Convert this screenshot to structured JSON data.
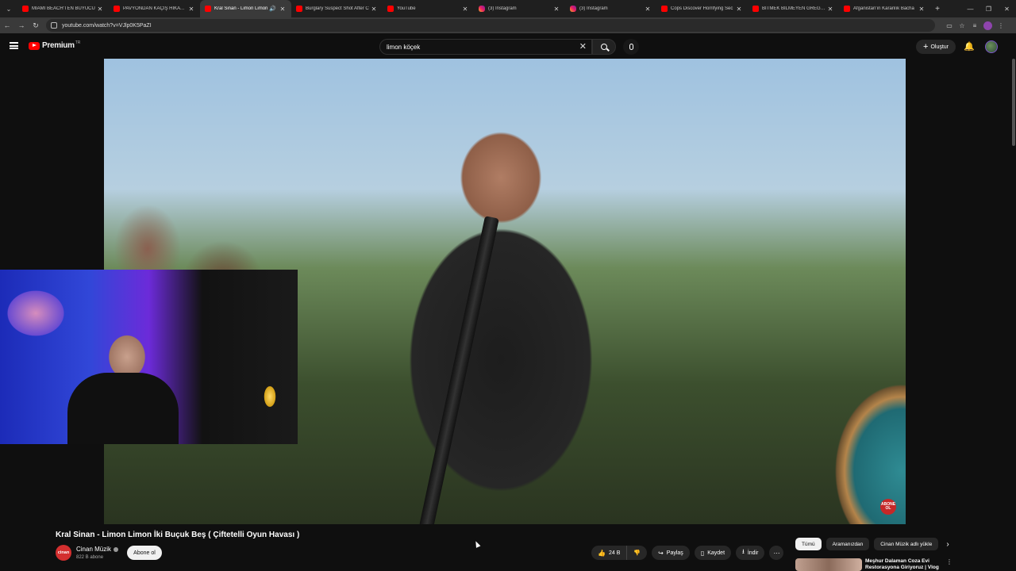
{
  "browser": {
    "tabs": [
      {
        "title": "MİAMİ BEACH'TEN BÜYÜCÜ",
        "icon": "youtube-icon",
        "active": false
      },
      {
        "title": "PAVYONDAN KAÇIŞ HİKAYESİ",
        "icon": "youtube-icon",
        "active": false
      },
      {
        "title": "Kral Sinan - Limon Limon",
        "icon": "youtube-icon",
        "active": true
      },
      {
        "title": "Burglary Suspect Shot After C",
        "icon": "youtube-icon",
        "active": false
      },
      {
        "title": "YouTube",
        "icon": "youtube-icon",
        "active": false
      },
      {
        "title": "(3) Instagram",
        "icon": "instagram-icon",
        "active": false
      },
      {
        "title": "(3) Instagram",
        "icon": "instagram-icon",
        "active": false
      },
      {
        "title": "Cops Discover Horrifying Sec",
        "icon": "youtube-icon",
        "active": false
      },
      {
        "title": "BİTMEK BİLMEYEN GREG FLE",
        "icon": "youtube-icon",
        "active": false
      },
      {
        "title": "Afganistan'ın Karanlık Bacha",
        "icon": "youtube-icon",
        "active": false
      }
    ],
    "url": "youtube.com/watch?v=VJlp0K5PaZI"
  },
  "header": {
    "brand": "Premium",
    "region": "TR",
    "search_value": "limon köçek",
    "create_label": "Oluştur"
  },
  "video": {
    "title": "Kral Sinan - Limon Limon İki Buçuk Beş ( Çiftetelli Oyun Havası )",
    "watermark": "ABONE OL"
  },
  "channel": {
    "avatar_text": "cinan",
    "name": "Cinan Müzik",
    "subscribers": "822 B abone",
    "subscribe_label": "Abone ol"
  },
  "actions": {
    "likes": "24 B",
    "share": "Paylaş",
    "save": "Kaydet",
    "download": "İndir"
  },
  "chips": [
    "Tümü",
    "Aramanızdan",
    "Cinan Müzik adlı yükle"
  ],
  "recommendation": {
    "title": "Meşhur Dalaman Coza Evi Restorasyona Giriyoruz | Vlog"
  }
}
